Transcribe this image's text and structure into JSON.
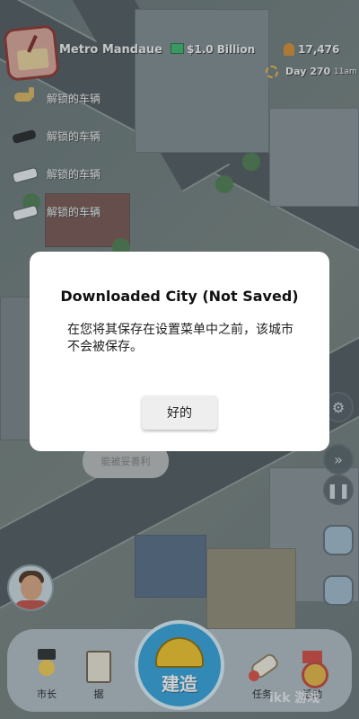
{
  "hud": {
    "city_name": "Metro Mandaue",
    "money": "$1.0 Billion",
    "population": "17,476",
    "day": "Day 270",
    "time": "11am"
  },
  "vehicles": [
    {
      "label": "解锁的车辆",
      "icon": "horse-icon"
    },
    {
      "label": "解锁的车辆",
      "icon": "black-car-icon"
    },
    {
      "label": "解锁的车辆",
      "icon": "white-car-icon"
    },
    {
      "label": "解锁的车辆",
      "icon": "white-car-icon"
    }
  ],
  "world": {
    "bubble_text": "能被妥善利"
  },
  "bottom_bar": {
    "mayor_label": "市长",
    "budget_label": "据",
    "build_label": "建造",
    "quests_label": "任务",
    "events_label": "活动"
  },
  "watermark": "ikk 游戏",
  "dialog": {
    "title": "Downloaded City (Not Saved)",
    "message": "在您将其保存在设置菜单中之前，该城市不会被保存。",
    "ok_label": "好的"
  },
  "colors": {
    "build_button": "#2f9fd8",
    "dialog_bg": "#ffffff",
    "ok_button_bg": "#eeeeee"
  }
}
